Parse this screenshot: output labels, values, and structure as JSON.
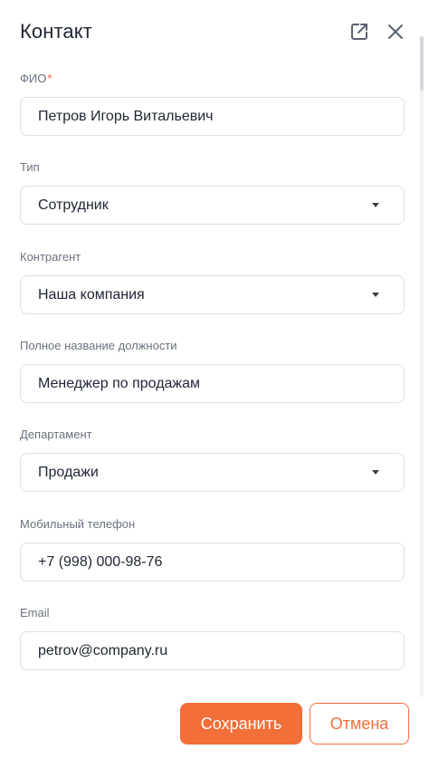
{
  "dialog": {
    "title": "Контакт"
  },
  "fields": {
    "fio": {
      "label": "ФИО",
      "required_mark": "*",
      "value": "Петров Игорь Витальевич"
    },
    "type": {
      "label": "Тип",
      "value": "Сотрудник"
    },
    "counterparty": {
      "label": "Контрагент",
      "value": "Наша компания"
    },
    "position": {
      "label": "Полное название должности",
      "value": "Менеджер по продажам"
    },
    "department": {
      "label": "Департамент",
      "value": "Продажи"
    },
    "mobile": {
      "label": "Мобильный телефон",
      "value": "+7 (998) 000-98-76"
    },
    "email": {
      "label": "Email",
      "value": "petrov@company.ru"
    }
  },
  "actions": {
    "save_label": "Сохранить",
    "cancel_label": "Отмена"
  },
  "icons": {
    "open_external": "external-link-icon",
    "close": "close-icon",
    "dropdown": "caret-down-icon"
  },
  "colors": {
    "accent": "#f26f3a",
    "required": "#f2542d",
    "label": "#6b7280",
    "text": "#1f2533",
    "border": "#dcdfe4"
  }
}
